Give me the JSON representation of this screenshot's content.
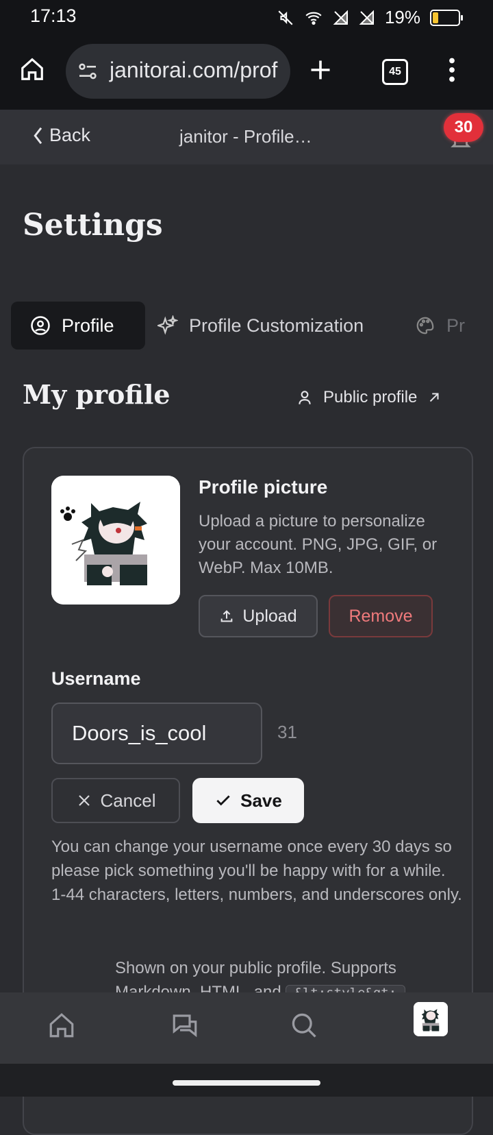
{
  "status_bar": {
    "time": "17:13",
    "battery_percent": "19%",
    "battery_level": 0.19
  },
  "browser": {
    "url": "janitorai.com/prof",
    "tab_count": "45"
  },
  "header": {
    "back_label": "Back",
    "title": "janitor - Profile…",
    "notification_count": "30"
  },
  "page": {
    "title": "Settings"
  },
  "tabs": [
    {
      "label": "Profile",
      "icon": "user-circle-icon",
      "active": true
    },
    {
      "label": "Profile Customization",
      "icon": "sparkles-icon",
      "active": false
    },
    {
      "label": "Pr",
      "icon": "palette-icon",
      "active": false
    }
  ],
  "section": {
    "title": "My profile",
    "public_profile_label": "Public profile"
  },
  "profile_picture": {
    "title": "Profile picture",
    "description": "Upload a picture to personalize your account. PNG, JPG, GIF, or WebP. Max 10MB.",
    "upload_label": "Upload",
    "remove_label": "Remove"
  },
  "username": {
    "label": "Username",
    "value": "Doors_is_cool",
    "remaining": "31",
    "cancel_label": "Cancel",
    "save_label": "Save",
    "help": "You can change your username once every 30 days so please pick something you'll be happy with for a while. 1-44 characters, letters, numbers, and underscores only."
  },
  "bio": {
    "help_prefix": "Shown on your public profile. Supports Markdown, HTML, and",
    "code": "&lt;style&gt;"
  },
  "colors": {
    "background": "#2b2c30",
    "danger": "#f07a7c",
    "badge": "#e2303a",
    "battery": "#f5c431"
  },
  "bottom_nav": [
    "home-icon",
    "chat-icon",
    "search-icon",
    "avatar"
  ]
}
